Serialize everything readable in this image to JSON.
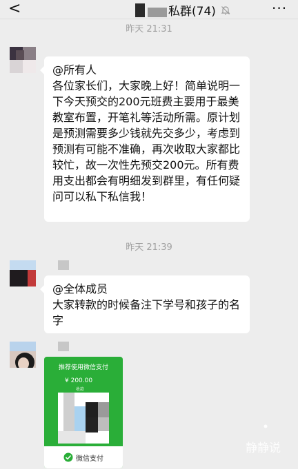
{
  "header": {
    "back_glyph": "<",
    "title": "私群(74)",
    "mute_icon": "bell-off-icon",
    "more_glyph": "···"
  },
  "messages": [
    {
      "timestamp": "昨天 21:31",
      "text": "@所有人\n各位家长们，大家晚上好！简单说明一下今天预交的200元班费主要用于最美教室布置，开笔礼等活动所需。原计划是预测需要多少钱就先交多少，考虑到预测有可能不准确，再次收取大家都比较忙，故一次性先预交200元。所有费用支出都会有明细发到群里，有任何疑问可以私下私信我！"
    },
    {
      "timestamp": "昨天 21:39",
      "text": "@全体成员\n大家转款的时候备注下学号和孩子的名字"
    }
  ],
  "payment_card": {
    "header": "推荐使用微信支付",
    "amount": "¥ 200.00",
    "sub": "收款",
    "footer": "微信支付",
    "brand_color": "#2aae38"
  },
  "watermark": "静静说",
  "colors": {
    "background": "#ededed",
    "bubble": "#ffffff",
    "timestamp": "#a0a0a0",
    "wechat_green": "#2aae38"
  }
}
